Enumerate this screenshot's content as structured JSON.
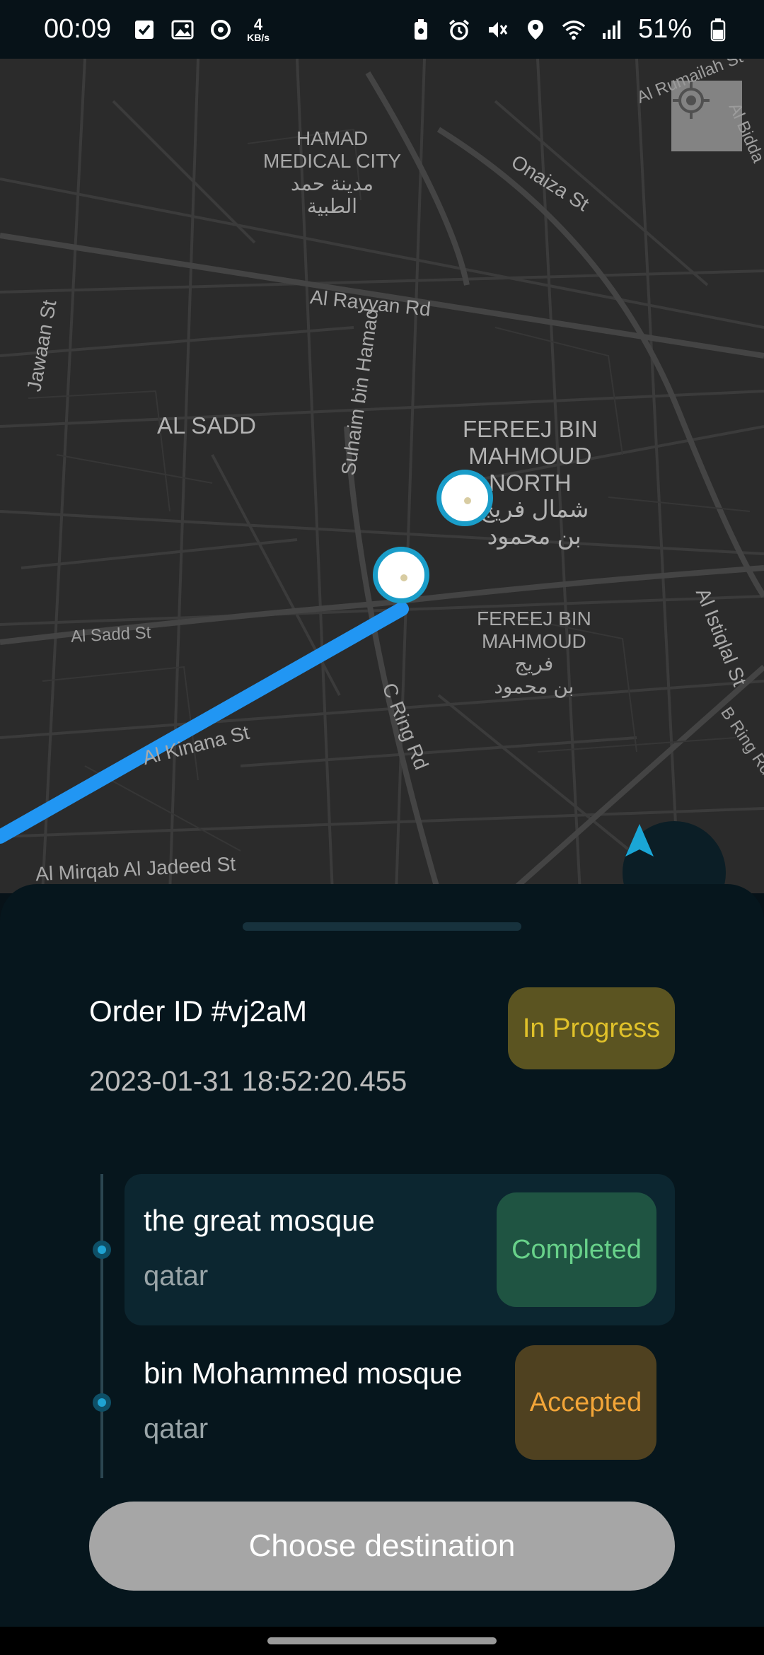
{
  "status_bar": {
    "time": "00:09",
    "net_speed_value": "4",
    "net_speed_unit": "KB/s",
    "battery": "51%",
    "left_icons": [
      "checkbox-icon",
      "gallery-icon",
      "sync-icon"
    ],
    "right_icons": [
      "battery-saver-icon",
      "alarm-icon",
      "mute-icon",
      "location-icon",
      "wifi-icon",
      "signal-icon",
      "battery-icon"
    ]
  },
  "map": {
    "labels": {
      "hamad": "HAMAD\nMEDICAL CITY\nمدينة حمد\nالطبية",
      "al_sadd": "AL SADD",
      "fereej_north": "FEREEJ BIN\nMAHMOUD\nNORTH",
      "fereej_north_ar": "شمال فريج\nبن محمود",
      "fereej": "FEREEJ BIN\nMAHMOUD\nفريج\nبن محمود",
      "al_rayyan": "Al Rayyan Rd",
      "onaiza": "Onaiza St",
      "jawaan": "Jawaan St",
      "suhaim": "Suhaim bin Hamad",
      "al_sadd_st": "Al Sadd St",
      "al_kinana": "Al Kinana St",
      "c_ring": "C Ring Rd",
      "al_istiqlal": "Al Istiqlal St",
      "b_ring": "B Ring Rd",
      "al_mirqab": "Al Mirqab Al Jadeed St",
      "al_rumailah": "Al Rumailah St",
      "al_bidda": "Al Bidda"
    },
    "route_color": "#2196f3",
    "pin_color": "#1a9dc9"
  },
  "order": {
    "id_label": "Order ID #vj2aM",
    "timestamp": "2023-01-31 18:52:20.455",
    "status": "In Progress"
  },
  "stops": [
    {
      "name": "the great mosque",
      "city": "qatar",
      "status": "Completed"
    },
    {
      "name": "bin Mohammed mosque",
      "city": "qatar",
      "status": "Accepted"
    }
  ],
  "actions": {
    "choose_destination": "Choose destination"
  }
}
